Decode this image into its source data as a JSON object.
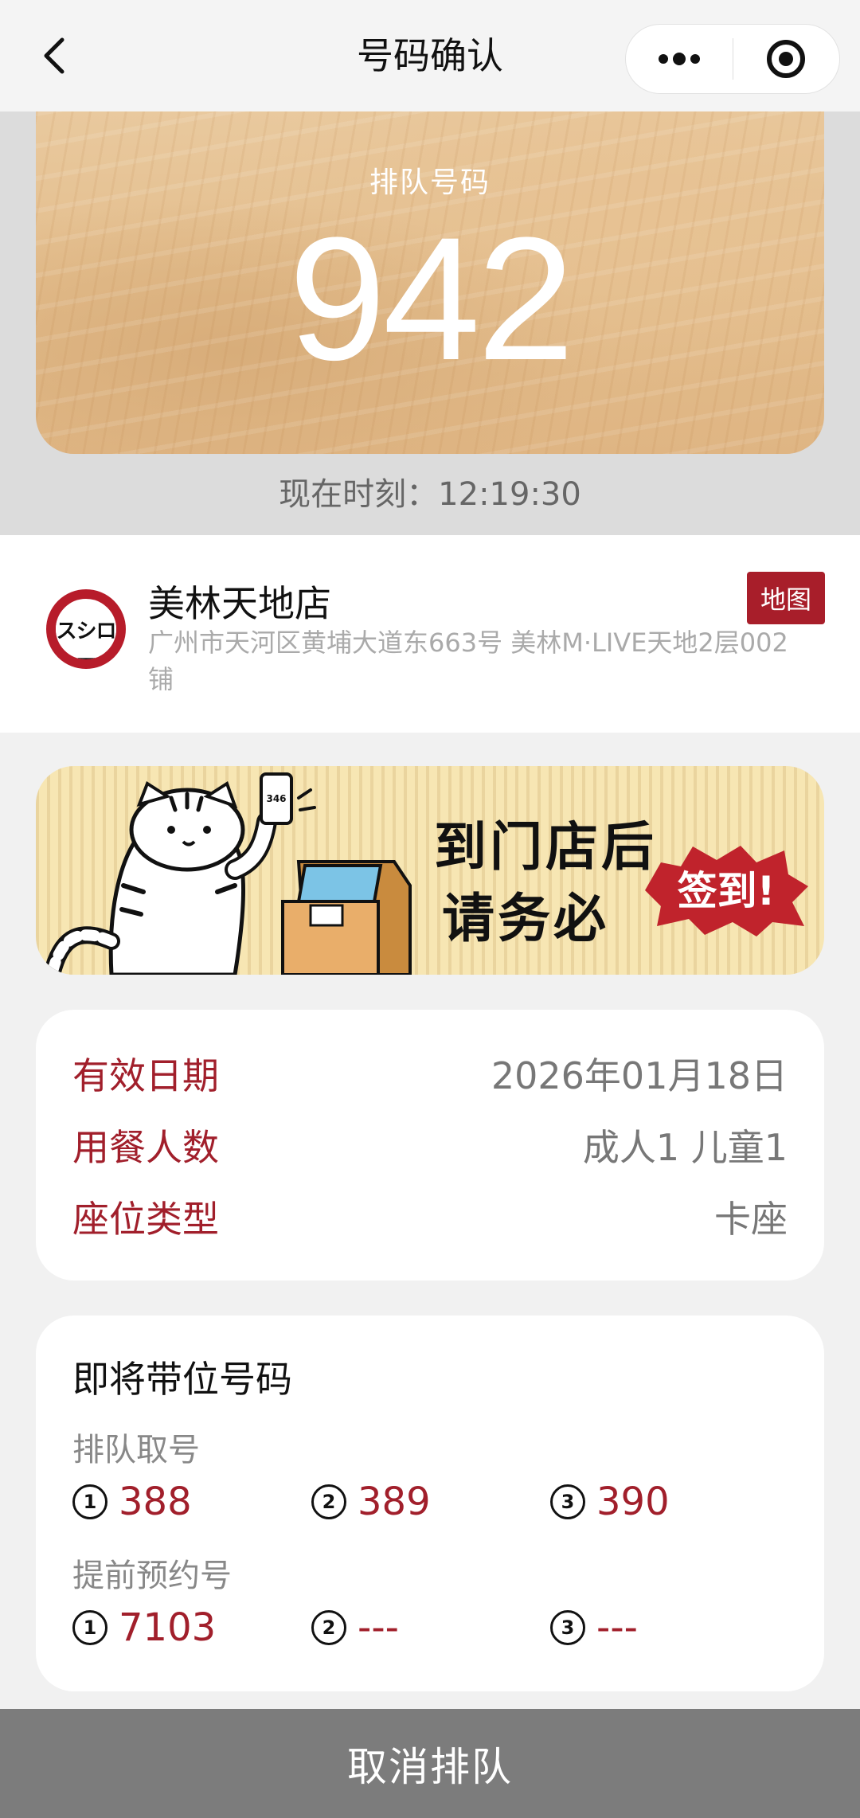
{
  "navbar": {
    "title": "号码确认",
    "back_icon": "chevron-left-icon",
    "more_icon": "more-dots-icon",
    "close_icon": "target-circle-icon"
  },
  "ticket": {
    "label": "排队号码",
    "number": "942",
    "time_label": "现在时刻：",
    "time_value": "12:19:30"
  },
  "store": {
    "logo_text": "スシロー",
    "name": "美林天地店",
    "address": "广州市天河区黄埔大道东663号 美林M·LIVE天地2层002铺",
    "map_button": "地图"
  },
  "banner": {
    "line1": "到门店后",
    "line2": "请务必",
    "signin": "签到!",
    "phone_number": "346"
  },
  "info": {
    "rows": [
      {
        "key": "有效日期",
        "value": "2026年01月18日"
      },
      {
        "key": "用餐人数",
        "value": "成人1 儿童1"
      },
      {
        "key": "座位类型",
        "value": "卡座"
      }
    ]
  },
  "upcoming": {
    "title": "即将带位号码",
    "queue_section": "排队取号",
    "queue_numbers": [
      {
        "index": "1",
        "value": "388"
      },
      {
        "index": "2",
        "value": "389"
      },
      {
        "index": "3",
        "value": "390"
      }
    ],
    "reserve_section": "提前预约号",
    "reserve_numbers": [
      {
        "index": "1",
        "value": "7103"
      },
      {
        "index": "2",
        "value": "---"
      },
      {
        "index": "3",
        "value": "---"
      }
    ]
  },
  "footer": {
    "cancel_label": "取消排队"
  },
  "colors": {
    "accent": "#a11f2b",
    "cancel_bg": "#7c7c7c"
  }
}
